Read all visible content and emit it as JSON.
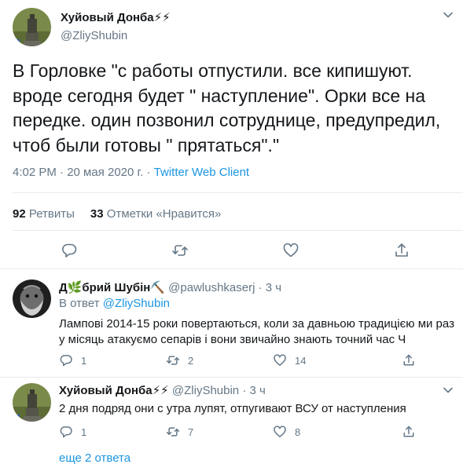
{
  "main": {
    "author": {
      "name": "Хуйовый Донба⚡⚡",
      "handle": "@ZliyShubin",
      "avatar_icon": "statue-avatar-icon"
    },
    "text": "В Горловке \"с работы отпустили. все кипишуют. вроде сегодня будет \" наступление\". Орки все на передке. один позвонил сотруднице, предупредил, чтоб были готовы \" прятаться\".\"",
    "time": "4:02 PM · 20 мая 2020 г. · ",
    "client": "Twitter Web Client",
    "retweets_count": "92",
    "retweets_label": "Ретвиты",
    "likes_count": "33",
    "likes_label": "Отметки «Нравится»"
  },
  "replies": [
    {
      "name": "Д🌿брий Шубін⛏️",
      "handle": "@pawlushkaserj",
      "time": " · 3 ч",
      "reply_to_label": "В ответ ",
      "reply_to": "@ZliyShubin",
      "text": "Лампові 2014-15 роки повертаються, коли за давньою традицією ми раз у місяць атакуємо сепарів і вони звичайно знають точний час Ч",
      "reply_count": "1",
      "retweet_count": "2",
      "like_count": "14",
      "avatar_icon": "bearded-face-avatar-icon"
    },
    {
      "name": "Хуйовый Донба⚡⚡",
      "handle": "@ZliyShubin",
      "time": " · 3 ч",
      "text": "2 дня подряд они с утра лупят, отпугивают ВСУ от наступления",
      "reply_count": "1",
      "retweet_count": "7",
      "like_count": "8",
      "avatar_icon": "statue-avatar-icon"
    }
  ],
  "more_replies": "еще 2 ответа",
  "colors": {
    "link": "#1b95e0",
    "secondary": "#657786",
    "primary": "#14171a",
    "border": "#e6ecf0"
  }
}
